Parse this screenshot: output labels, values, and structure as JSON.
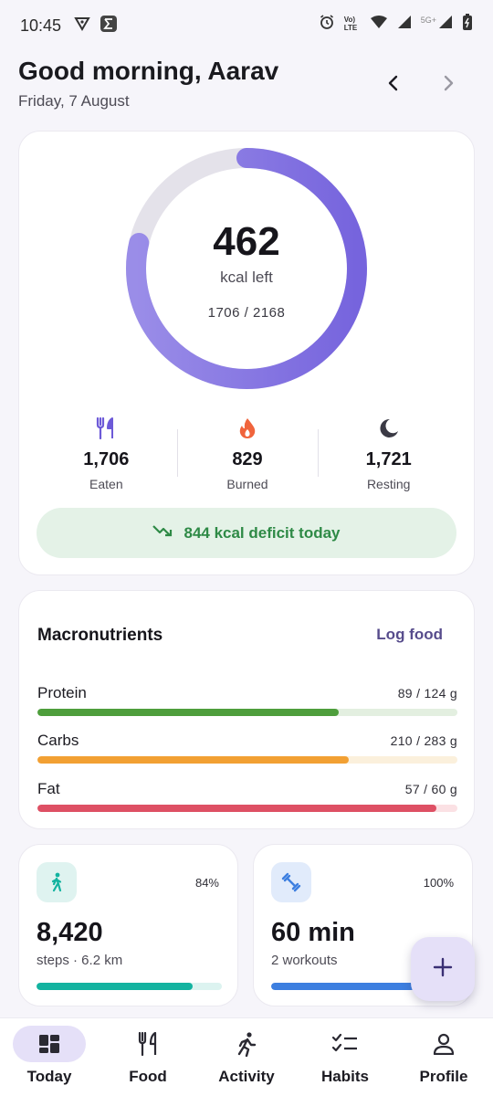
{
  "status_bar": {
    "time": "10:45",
    "network_label": "Vo) LTE",
    "network_5g": "5G+"
  },
  "header": {
    "greeting": "Good morning, Aarav",
    "date": "Friday, 7 August"
  },
  "calories": {
    "kcal_left": "462",
    "kcal_left_label": "kcal left",
    "ratio_text": "1706 / 2168",
    "consumed": 1706,
    "goal": 2168,
    "ring_color": "#7b67e0",
    "ring_track_color": "#e4e2ea"
  },
  "stats": [
    {
      "icon": "fork-knife-icon",
      "value": "1,706",
      "label": "Eaten",
      "color": "#6d5ad8"
    },
    {
      "icon": "flame-icon",
      "value": "829",
      "label": "Burned",
      "color": "#f0643c"
    },
    {
      "icon": "moon-icon",
      "value": "1,721",
      "label": "Resting",
      "color": "#3b3a45"
    }
  ],
  "deficit": {
    "text": "844 kcal deficit today",
    "icon": "trending-down-icon",
    "color": "#2e8a46"
  },
  "macros": {
    "title": "Macronutrients",
    "action": "Log food",
    "items": [
      {
        "name": "Protein",
        "amount": "89 / 124 g",
        "current": 89,
        "goal": 124,
        "color": "#4e9e3c",
        "track": "#e3efe0"
      },
      {
        "name": "Carbs",
        "amount": "210 / 283 g",
        "current": 210,
        "goal": 283,
        "color": "#f2a033",
        "track": "#fbf0dc"
      },
      {
        "name": "Fat",
        "amount": "57 / 60 g",
        "current": 57,
        "goal": 60,
        "color": "#de5064",
        "track": "#fbe1e4"
      }
    ]
  },
  "activity_cards": [
    {
      "icon": "walking-icon",
      "percent": "84%",
      "progress": 0.84,
      "value": "8,420",
      "sub": "steps · 6.2 km",
      "color": "#13b3a0",
      "icon_bg": "#dff3f0",
      "track": "#dcf3f0"
    },
    {
      "icon": "dumbbell-icon",
      "percent": "100%",
      "progress": 1.0,
      "value": "60 min",
      "sub": "2 workouts",
      "color": "#3d7fe0",
      "icon_bg": "#e1ebfb",
      "track": "#e1ebfb"
    }
  ],
  "fab": {
    "icon": "plus-icon"
  },
  "bottom_nav": {
    "items": [
      {
        "label": "Today",
        "icon": "dashboard-icon",
        "active": true
      },
      {
        "label": "Food",
        "icon": "fork-knife-icon",
        "active": false
      },
      {
        "label": "Activity",
        "icon": "running-icon",
        "active": false
      },
      {
        "label": "Habits",
        "icon": "checklist-icon",
        "active": false
      },
      {
        "label": "Profile",
        "icon": "person-icon",
        "active": false
      }
    ]
  }
}
